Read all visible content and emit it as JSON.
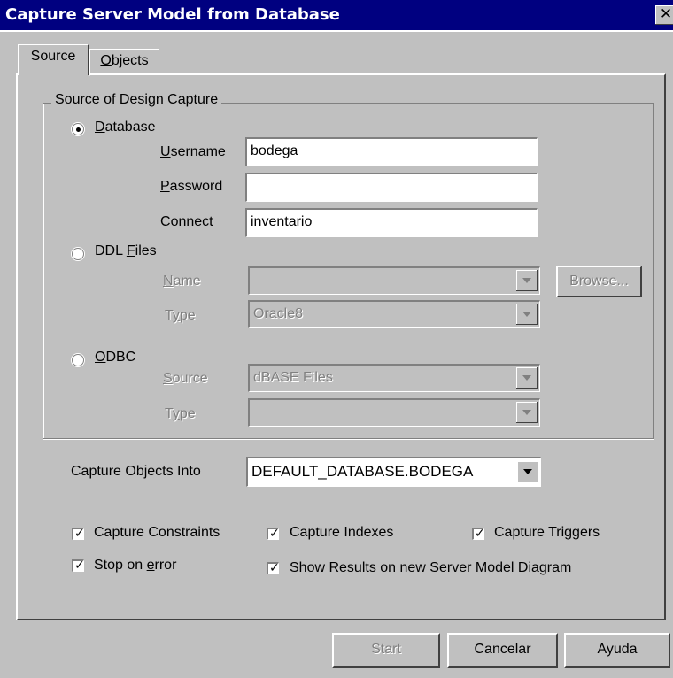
{
  "window": {
    "title": "Capture Server Model from Database",
    "close_icon": "close-icon"
  },
  "tabs": [
    {
      "label": "Source",
      "active": true
    },
    {
      "label": "Objects",
      "active": false
    }
  ],
  "source_group": {
    "legend": "Source of Design Capture",
    "database": {
      "label_prefix": "",
      "label_mnemonic": "D",
      "label_rest": "atabase",
      "selected": true,
      "username": {
        "mnemonic": "U",
        "rest": "sername",
        "value": "bodega"
      },
      "password": {
        "mnemonic": "P",
        "rest": "assword",
        "value": ""
      },
      "connect": {
        "mnemonic": "C",
        "rest": "onnect",
        "value": "inventario"
      }
    },
    "ddl": {
      "label_prefix": "DDL ",
      "label_mnemonic": "F",
      "label_rest": "iles",
      "selected": false,
      "name": {
        "mnemonic": "N",
        "rest": "ame",
        "value": ""
      },
      "type": {
        "prefix": "T",
        "mnemonic": "y",
        "rest": "pe",
        "value": "Oracle8"
      },
      "browse_label": "Browse..."
    },
    "odbc": {
      "label_prefix": "",
      "label_mnemonic": "O",
      "label_rest": "DBC",
      "selected": false,
      "source": {
        "mnemonic": "S",
        "rest": "ource",
        "value": "dBASE Files"
      },
      "type": {
        "prefix": "T",
        "mnemonic": "y",
        "rest": "pe",
        "value": ""
      }
    }
  },
  "capture_into": {
    "label": "Capture  Objects Into",
    "value": "DEFAULT_DATABASE.BODEGA"
  },
  "options": {
    "constraints": {
      "label": "Capture Constraints",
      "checked": true
    },
    "indexes": {
      "label": "Capture Indexes",
      "checked": true
    },
    "triggers": {
      "label": "Capture Triggers",
      "checked": true
    },
    "stop_on_error": {
      "prefix": "Stop on ",
      "mnemonic": "e",
      "rest": "rror",
      "checked": true
    },
    "show_results": {
      "label": "Show Results on new Server Model Diagram",
      "checked": true
    }
  },
  "buttons": {
    "start": "Start",
    "cancel": "Cancelar",
    "help": "Ayuda"
  },
  "colors": {
    "titlebar": "#000080",
    "face": "#c0c0c0",
    "disabled_text": "#808080"
  }
}
